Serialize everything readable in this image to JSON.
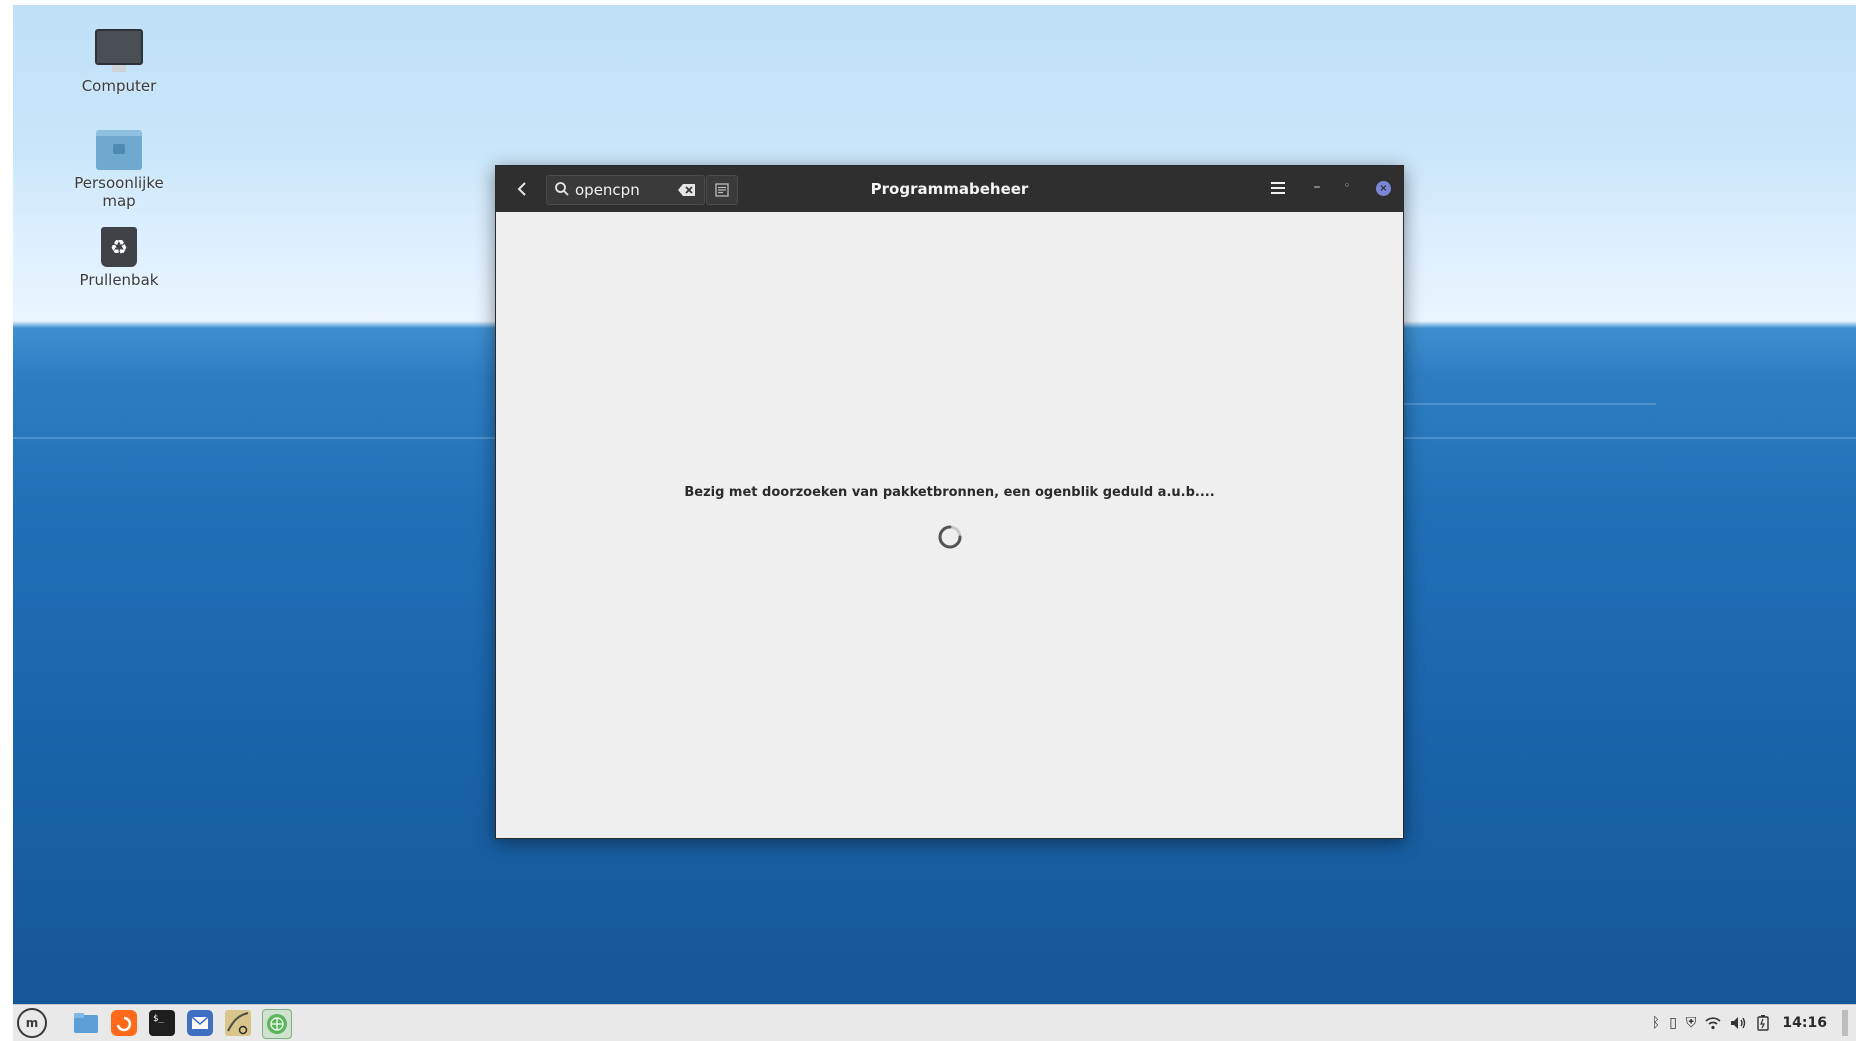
{
  "desktop": {
    "icons": [
      {
        "label": "Computer",
        "icon": "computer-icon"
      },
      {
        "label": "Persoonlijke map",
        "icon": "home-folder-icon"
      },
      {
        "label": "Prullenbak",
        "icon": "trash-icon"
      }
    ]
  },
  "window": {
    "title": "Programmabeheer",
    "search": {
      "value": "opencpn",
      "placeholder": ""
    },
    "loading_text": "Bezig met doorzoeken van pakketbronnen, een ogenblik geduld a.u.b....",
    "accent_color": "#7c86d8"
  },
  "taskbar": {
    "menu_label": "m",
    "launchers": [
      "file-manager-icon",
      "firefox-icon",
      "terminal-icon",
      "mail-icon",
      "image-viewer-icon",
      "software-manager-icon"
    ],
    "tray_icons": [
      "bluetooth-icon",
      "clipboard-icon",
      "update-shield-icon",
      "wifi-icon",
      "volume-icon",
      "battery-icon"
    ],
    "clock": "14:16"
  }
}
